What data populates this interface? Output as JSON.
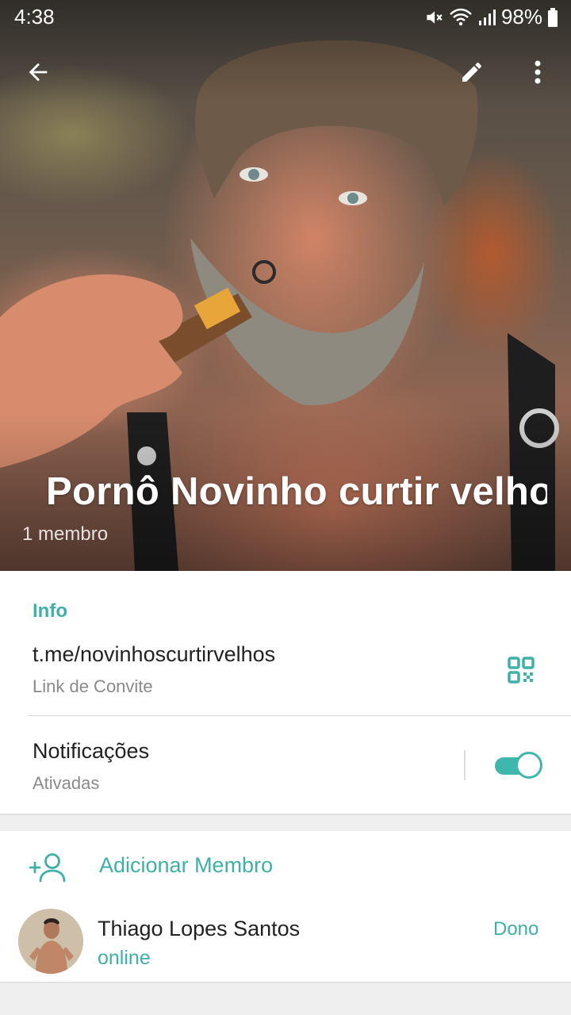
{
  "status_bar": {
    "time": "4:38",
    "battery": "98%",
    "icons": [
      "mute-icon",
      "wifi-icon",
      "signal-icon",
      "battery-icon"
    ]
  },
  "toolbar": {
    "back_icon": "arrow-back-icon",
    "edit_icon": "pencil-icon",
    "more_icon": "more-vertical-icon"
  },
  "group": {
    "title": "Pornô Novinho curtir velhos",
    "members": "1 membro"
  },
  "info": {
    "section_title": "Info",
    "invite_link": "t.me/novinhoscurtirvelhos",
    "invite_label": "Link de Convite",
    "qr_icon": "qr-code-icon",
    "notifications_label": "Notificações",
    "notifications_status": "Ativadas",
    "notifications_enabled": true
  },
  "members": {
    "add_label": "Adicionar Membro",
    "add_icon": "add-person-icon",
    "list": [
      {
        "name": "Thiago Lopes Santos",
        "status": "online",
        "role": "Dono"
      }
    ]
  },
  "colors": {
    "accent": "#3fb0a6",
    "toggle": "#3fb7ad",
    "text_primary": "#222222",
    "text_secondary": "#8a8a8a",
    "background": "#efefef"
  }
}
